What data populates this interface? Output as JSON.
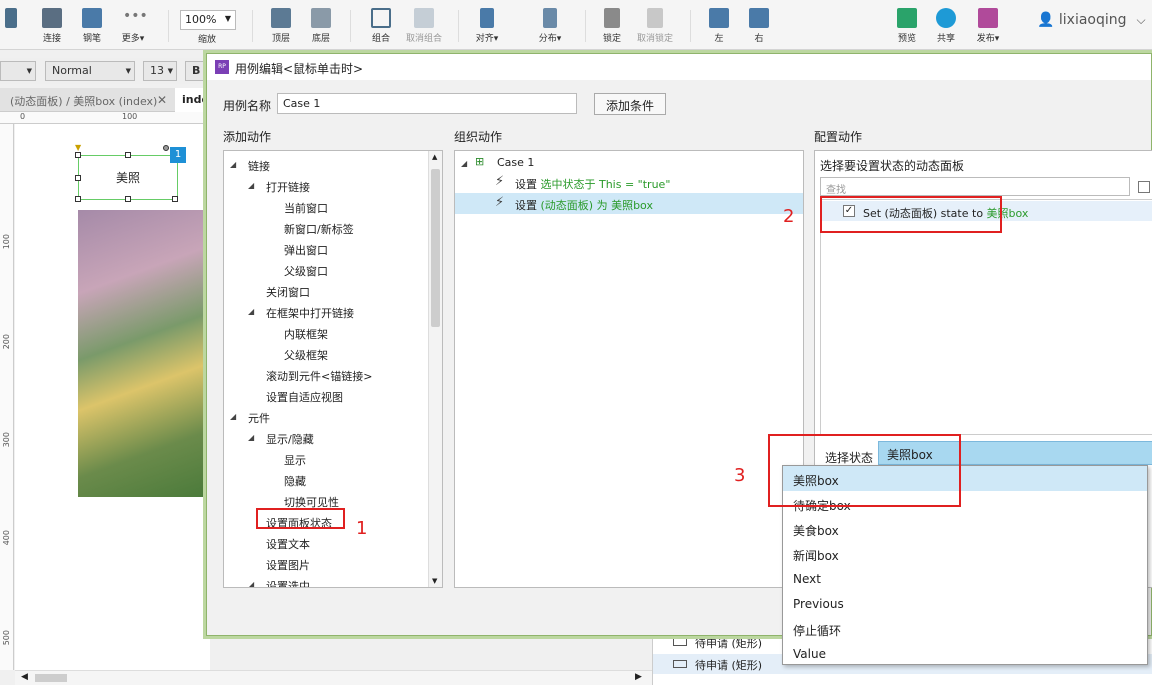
{
  "toolbar": {
    "items": [
      "连接",
      "钢笔",
      "更多▾",
      "缩放",
      "顶层",
      "底层",
      "组合",
      "取消组合",
      "对齐▾",
      "分布▾",
      "锁定",
      "取消锁定",
      "左",
      "右",
      "预览",
      "共享",
      "发布▾"
    ],
    "zoom": "100%",
    "user": "lixiaoqing"
  },
  "format": {
    "style": "Normal",
    "size": "13",
    "bold": "B"
  },
  "tabs": [
    "(动态面板) / 美照box (index)",
    "inde"
  ],
  "ruler": {
    "h": [
      "0",
      "100"
    ],
    "v": [
      "100",
      "200",
      "300",
      "400",
      "500"
    ]
  },
  "canvas": {
    "widget_label": "美照",
    "badge": "1"
  },
  "bottom_panel": {
    "rows": [
      "待申请 (矩形)",
      "待申请 (矩形)"
    ]
  },
  "dialog": {
    "title": "用例编辑<鼠标单击时>",
    "case_name_label": "用例名称",
    "case_name_value": "Case 1",
    "add_condition": "添加条件",
    "col_add": "添加动作",
    "col_org": "组织动作",
    "col_cfg": "配置动作",
    "actions": [
      {
        "label": "链接",
        "level": 0,
        "expand": true
      },
      {
        "label": "打开链接",
        "level": 1,
        "expand": true
      },
      {
        "label": "当前窗口",
        "level": 2
      },
      {
        "label": "新窗口/新标签",
        "level": 2
      },
      {
        "label": "弹出窗口",
        "level": 2
      },
      {
        "label": "父级窗口",
        "level": 2
      },
      {
        "label": "关闭窗口",
        "level": 1
      },
      {
        "label": "在框架中打开链接",
        "level": 1,
        "expand": true
      },
      {
        "label": "内联框架",
        "level": 2
      },
      {
        "label": "父级框架",
        "level": 2
      },
      {
        "label": "滚动到元件<锚链接>",
        "level": 1
      },
      {
        "label": "设置自适应视图",
        "level": 1
      },
      {
        "label": "元件",
        "level": 0,
        "expand": true
      },
      {
        "label": "显示/隐藏",
        "level": 1,
        "expand": true
      },
      {
        "label": "显示",
        "level": 2
      },
      {
        "label": "隐藏",
        "level": 2
      },
      {
        "label": "切换可见性",
        "level": 2
      },
      {
        "label": "设置面板状态",
        "level": 1
      },
      {
        "label": "设置文本",
        "level": 1
      },
      {
        "label": "设置图片",
        "level": 1
      },
      {
        "label": "设置选中",
        "level": 1,
        "expand": true
      }
    ],
    "org": {
      "case": "Case 1",
      "steps": [
        {
          "prefix": "设置 ",
          "green": "选中状态于 This = \"true\"",
          "selected": false
        },
        {
          "prefix": "设置 ",
          "green": "(动态面板) 为 美照box",
          "selected": true
        }
      ]
    },
    "config": {
      "header": "选择要设置状态的动态面板",
      "search_placeholder": "查找",
      "item_prefix": "Set (动态面板) state to ",
      "item_green": "美照box",
      "state_label": "选择状态",
      "state_value": "美照box"
    },
    "dropdown": [
      "美照box",
      "待确定box",
      "美食box",
      "新闻box",
      "Next",
      "Previous",
      "停止循环",
      "Value"
    ]
  },
  "annotations": [
    "1",
    "2",
    "3"
  ]
}
